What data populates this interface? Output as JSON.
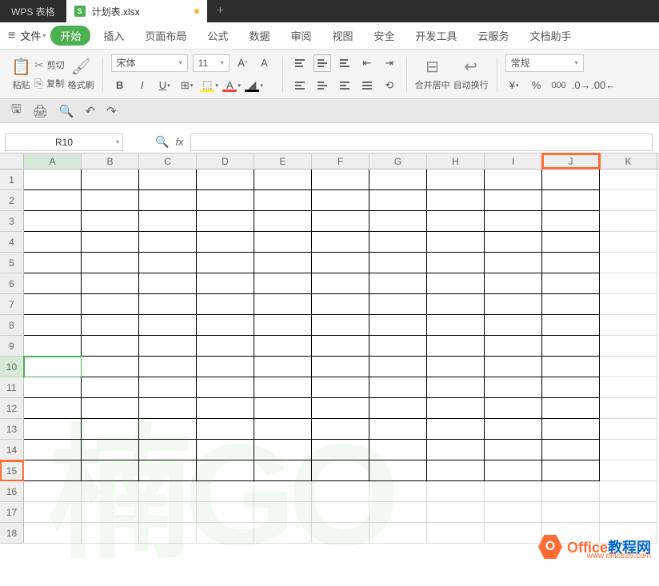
{
  "app": {
    "name": "WPS 表格"
  },
  "document": {
    "filename": "计划表.xlsx",
    "modified": true
  },
  "menu": {
    "file": "文件",
    "tabs": [
      "开始",
      "插入",
      "页面布局",
      "公式",
      "数据",
      "审阅",
      "视图",
      "安全",
      "开发工具",
      "云服务",
      "文档助手"
    ],
    "active": "开始"
  },
  "ribbon": {
    "paste": "粘贴",
    "cut": "剪切",
    "copy": "复制",
    "format_painter": "格式刷",
    "font_name": "宋体",
    "font_size": "11",
    "merge_center": "合并居中",
    "wrap_text": "自动换行",
    "number_format": "常规"
  },
  "formula_bar": {
    "cell_ref": "R10",
    "fx": "fx",
    "value": ""
  },
  "grid": {
    "columns": [
      "A",
      "B",
      "C",
      "D",
      "E",
      "F",
      "G",
      "H",
      "I",
      "J",
      "K"
    ],
    "rows": [
      "1",
      "2",
      "3",
      "4",
      "5",
      "6",
      "7",
      "8",
      "9",
      "10",
      "11",
      "12",
      "13",
      "14",
      "15",
      "16",
      "17",
      "18"
    ],
    "active_cell": {
      "row": 10,
      "col": "A"
    },
    "selected_row_header": 10,
    "highlighted_col": "J",
    "highlighted_row": "15",
    "bordered_range": {
      "rows": [
        1,
        15
      ],
      "cols": [
        "A",
        "J"
      ]
    }
  },
  "watermark": "楠GO",
  "branding": {
    "text1": "Office",
    "text2": "教程网",
    "url": "www.office26.com"
  }
}
